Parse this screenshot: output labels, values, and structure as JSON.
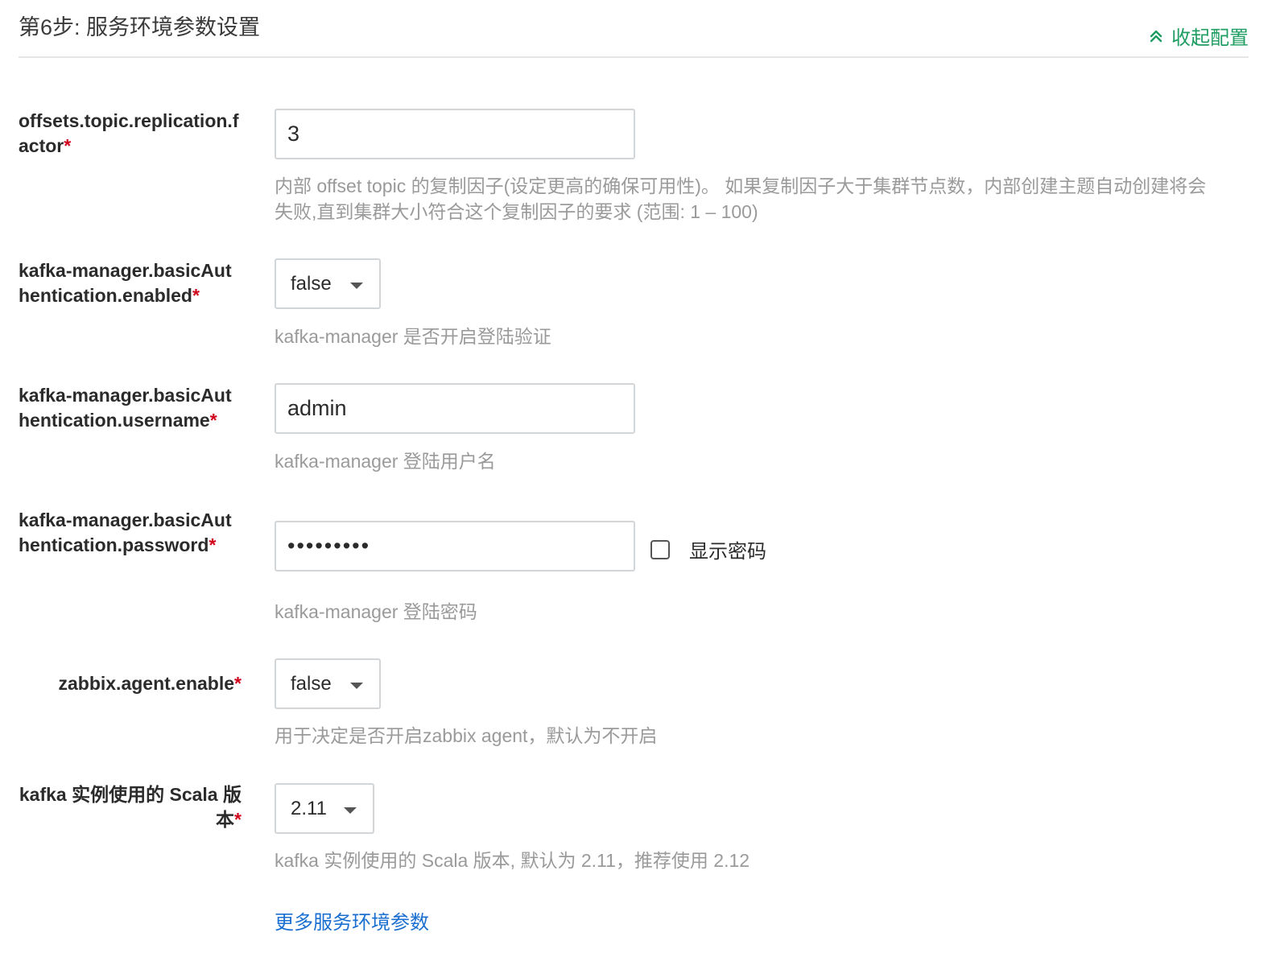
{
  "header": {
    "step_title": "第6步: 服务环境参数设置",
    "collapse_label": "收起配置",
    "collapse_icon": "chevron-double-up-icon",
    "accent_color": "#1f9d62"
  },
  "fields": {
    "replication_factor": {
      "label": "offsets.topic.replication.factor",
      "required_mark": "*",
      "value": "3",
      "help": "内部 offset topic 的复制因子(设定更高的确保可用性)。 如果复制因子大于集群节点数，内部创建主题自动创建将会失败,直到集群大小符合这个复制因子的要求 (范围: 1 – 100)"
    },
    "basic_auth_enabled": {
      "label": "kafka-manager.basicAuthentication.enabled",
      "required_mark": "*",
      "value": "false",
      "help": "kafka-manager 是否开启登陆验证"
    },
    "basic_auth_username": {
      "label": "kafka-manager.basicAuthentication.username",
      "required_mark": "*",
      "value": "admin",
      "help": "kafka-manager 登陆用户名"
    },
    "basic_auth_password": {
      "label": "kafka-manager.basicAuthentication.password",
      "required_mark": "*",
      "value": "•••••••••",
      "show_password_label": "显示密码",
      "show_password_checked": false,
      "help": "kafka-manager 登陆密码"
    },
    "zabbix_agent_enable": {
      "label": "zabbix.agent.enable",
      "required_mark": "*",
      "value": "false",
      "help": "用于决定是否开启zabbix agent，默认为不开启"
    },
    "scala_version": {
      "label": "kafka 实例使用的 Scala 版本",
      "required_mark": "*",
      "value": "2.11",
      "help": "kafka 实例使用的 Scala 版本, 默认为 2.11，推荐使用 2.12"
    }
  },
  "more_link": "更多服务环境参数",
  "colors": {
    "required": "#d0021b",
    "link": "#1a6fd1",
    "help_text": "#9a9a9a"
  }
}
